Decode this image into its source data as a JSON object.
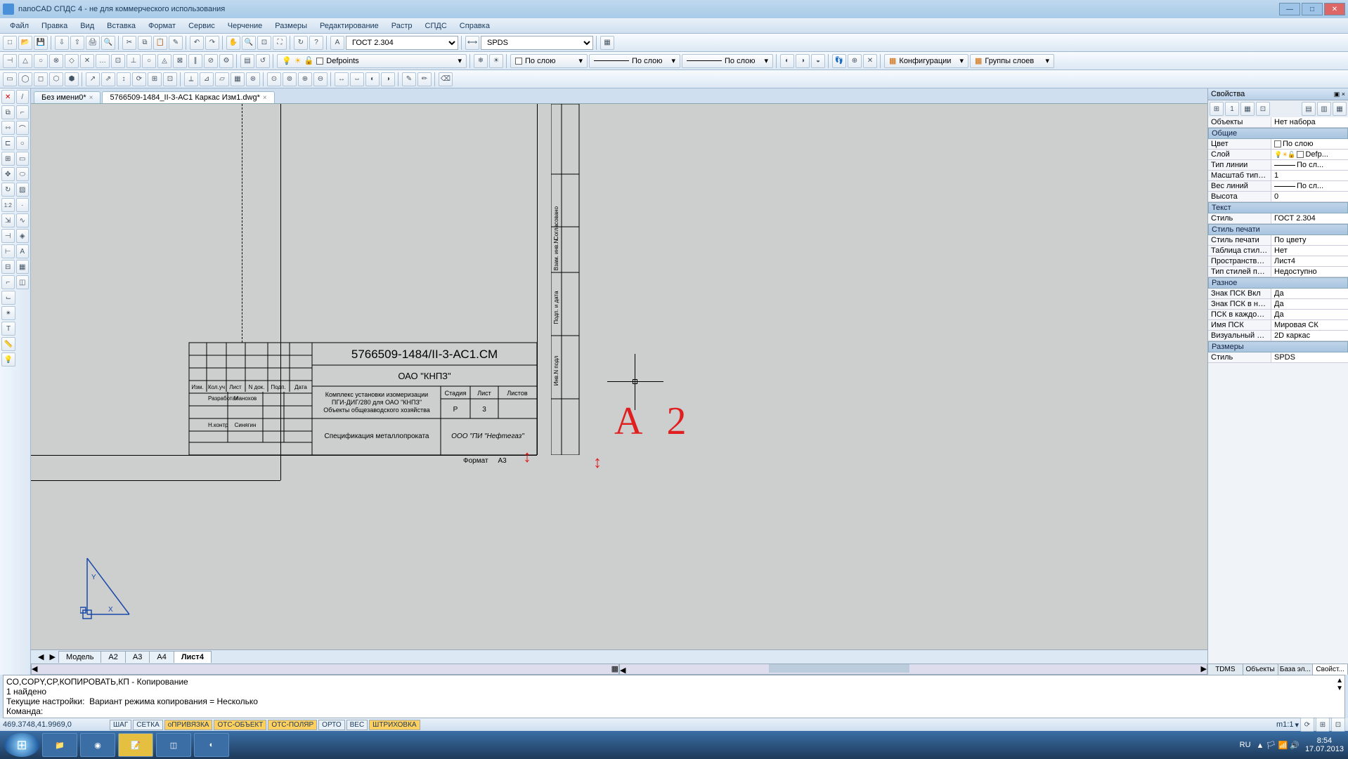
{
  "window": {
    "title": "nanoCAD СПДС 4 - не для коммерческого использования"
  },
  "menus": [
    "Файл",
    "Правка",
    "Вид",
    "Вставка",
    "Формат",
    "Сервис",
    "Черчение",
    "Размеры",
    "Редактирование",
    "Растр",
    "СПДС",
    "Справка"
  ],
  "toolbar1": {
    "text_style_dropdown": "ГОСТ 2.304",
    "dim_style_dropdown": "SPDS"
  },
  "toolbar2": {
    "layer_dropdown": "Defpoints",
    "color_dropdown": "По слою",
    "linetype_dropdown": "По слою",
    "lineweight_dropdown": "По слою",
    "config_label": "Конфигурации",
    "groups_label": "Группы слоев"
  },
  "doc_tabs": [
    {
      "label": "Без имени0*",
      "active": false
    },
    {
      "label": "5766509-1484_II-3-АС1 Каркас Изм1.dwg*",
      "active": true
    }
  ],
  "model_tabs": [
    "Модель",
    "А2",
    "А3",
    "А4",
    "Лист4"
  ],
  "model_tab_active": "Лист4",
  "drawing": {
    "title_block": {
      "drawing_no": "5766509-1484/II-3-АС1.СМ",
      "client": "ОАО \"КНПЗ\"",
      "desc_line1": "Комплекс установки изомеризации",
      "desc_line2": "ПГИ-ДИГ/280 для ОАО \"КНПЗ\"",
      "desc_line3": "Объекты общезаводского хозяйства",
      "spec": "Спецификация металлопроката",
      "contractor": "ООО \"ПИ \"Нефтегаз\"",
      "stage_hdr": "Стадия",
      "sheet_hdr": "Лист",
      "sheets_hdr": "Листов",
      "stage": "Р",
      "sheet": "3",
      "sheets": "",
      "col_izm": "Изм.",
      "col_kol": "Кол.уч",
      "col_list": "Лист",
      "col_ndoc": "N док.",
      "col_podp": "Подп.",
      "col_date": "Дата",
      "row_razrab": "Разработал",
      "row_razrab_name": "Манохов",
      "row_nkontr": "Н.контр",
      "row_nkontr_name": "Синягин",
      "format_label": "Формат",
      "format_value": "А3",
      "side_soglas": "Согласовано",
      "side_vzam": "Взам. инв.N",
      "side_podp": "Подп. и дата",
      "side_inv": "Инв.N подл"
    },
    "red_text": "А 2",
    "ucs": {
      "x": "X",
      "y": "Y"
    }
  },
  "command_lines": [
    "CO,COPY,CP,КОПИРОВАТЬ,КП - Копирование",
    "1 найдено",
    "Текущие настройки:  Вариант режима копирования = Несколько"
  ],
  "command_prompt": "Команда:",
  "statusbar": {
    "coords": "469.3748,41.9969,0",
    "buttons": [
      {
        "label": "ШАГ",
        "on": false
      },
      {
        "label": "СЕТКА",
        "on": false
      },
      {
        "label": "оПРИВЯЗКА",
        "on": true
      },
      {
        "label": "ОТС-ОБЪЕКТ",
        "on": true
      },
      {
        "label": "ОТС-ПОЛЯР",
        "on": true
      },
      {
        "label": "ОРТО",
        "on": false
      },
      {
        "label": "ВЕС",
        "on": false
      },
      {
        "label": "ШТРИХОВКА",
        "on": true
      }
    ],
    "lang": "RU",
    "scale": "m1:1",
    "time": "8:54",
    "date": "17.07.2013"
  },
  "properties": {
    "title": "Свойства",
    "objects_label": "Объекты",
    "objects_value": "Нет набора",
    "sections": [
      {
        "name": "Общие",
        "rows": [
          {
            "k": "Цвет",
            "v": "По слою",
            "swatch": "#fff"
          },
          {
            "k": "Слой",
            "v": "Defp...",
            "layer_icons": true
          },
          {
            "k": "Тип линии",
            "v": "По сл...",
            "line": true
          },
          {
            "k": "Масштаб типа ...",
            "v": "1"
          },
          {
            "k": "Вес линий",
            "v": "По сл...",
            "line": true
          },
          {
            "k": "Высота",
            "v": "0"
          }
        ]
      },
      {
        "name": "Текст",
        "rows": [
          {
            "k": "Стиль",
            "v": "ГОСТ 2.304"
          }
        ]
      },
      {
        "name": "Стиль печати",
        "rows": [
          {
            "k": "Стиль печати",
            "v": "По цвету"
          },
          {
            "k": "Таблица стиле...",
            "v": "Нет"
          },
          {
            "k": "Пространство ...",
            "v": "Лист4"
          },
          {
            "k": "Тип стилей печ...",
            "v": "Недоступно"
          }
        ]
      },
      {
        "name": "Разное",
        "rows": [
          {
            "k": "Знак ПСК Вкл",
            "v": "Да"
          },
          {
            "k": "Знак ПСК в на...",
            "v": "Да"
          },
          {
            "k": "ПСК в каждом ...",
            "v": "Да"
          },
          {
            "k": "Имя ПСК",
            "v": "Мировая СК"
          },
          {
            "k": "Визуальный ст...",
            "v": "2D каркас"
          }
        ]
      },
      {
        "name": "Размеры",
        "rows": [
          {
            "k": "Стиль",
            "v": "SPDS"
          }
        ]
      }
    ],
    "bottom_tabs": [
      "TDMS",
      "Объекты",
      "База эл...",
      "Свойст..."
    ],
    "bottom_active": "Свойст..."
  }
}
